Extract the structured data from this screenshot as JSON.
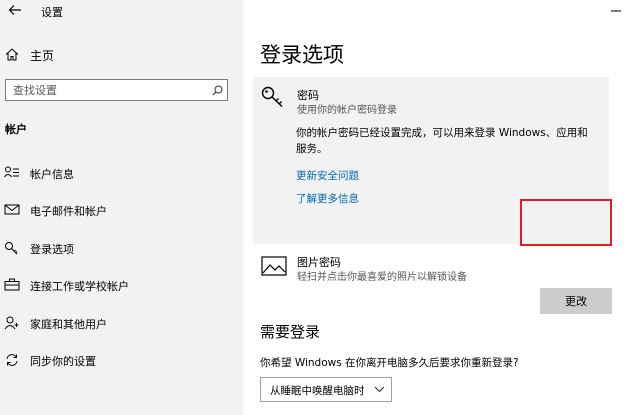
{
  "window": {
    "title": "设置"
  },
  "sidebar": {
    "home_label": "主页",
    "search_placeholder": "查找设置",
    "section_header": "帐户",
    "items": [
      {
        "label": "帐户信息",
        "icon": "account-info-icon"
      },
      {
        "label": "电子邮件和帐户",
        "icon": "mail-icon"
      },
      {
        "label": "登录选项",
        "icon": "key-icon"
      },
      {
        "label": "连接工作或学校帐户",
        "icon": "briefcase-icon"
      },
      {
        "label": "家庭和其他用户",
        "icon": "add-person-icon"
      },
      {
        "label": "同步你的设置",
        "icon": "sync-icon"
      }
    ]
  },
  "main": {
    "page_title": "登录选项",
    "password": {
      "title": "密码",
      "subtitle": "使用你的帐户密码登录",
      "description": "你的帐户密码已经设置完成，可以用来登录 Windows、应用和服务。",
      "link_security": "更新安全问题",
      "link_more": "了解更多信息",
      "button_label": "更改"
    },
    "picture_password": {
      "title": "图片密码",
      "subtitle": "轻扫并点击你最喜爱的照片以解锁设备"
    },
    "require_signin": {
      "header": "需要登录",
      "question": "你希望 Windows 在你离开电脑多久后要求你重新登录?",
      "selected": "从睡眠中唤醒电脑时"
    }
  },
  "colors": {
    "accent_link": "#0067b8",
    "highlight_border": "#e02020",
    "sidebar_bg": "#f2f2f2",
    "card_bg": "#f2f2f2",
    "button_bg": "#cccccc"
  }
}
